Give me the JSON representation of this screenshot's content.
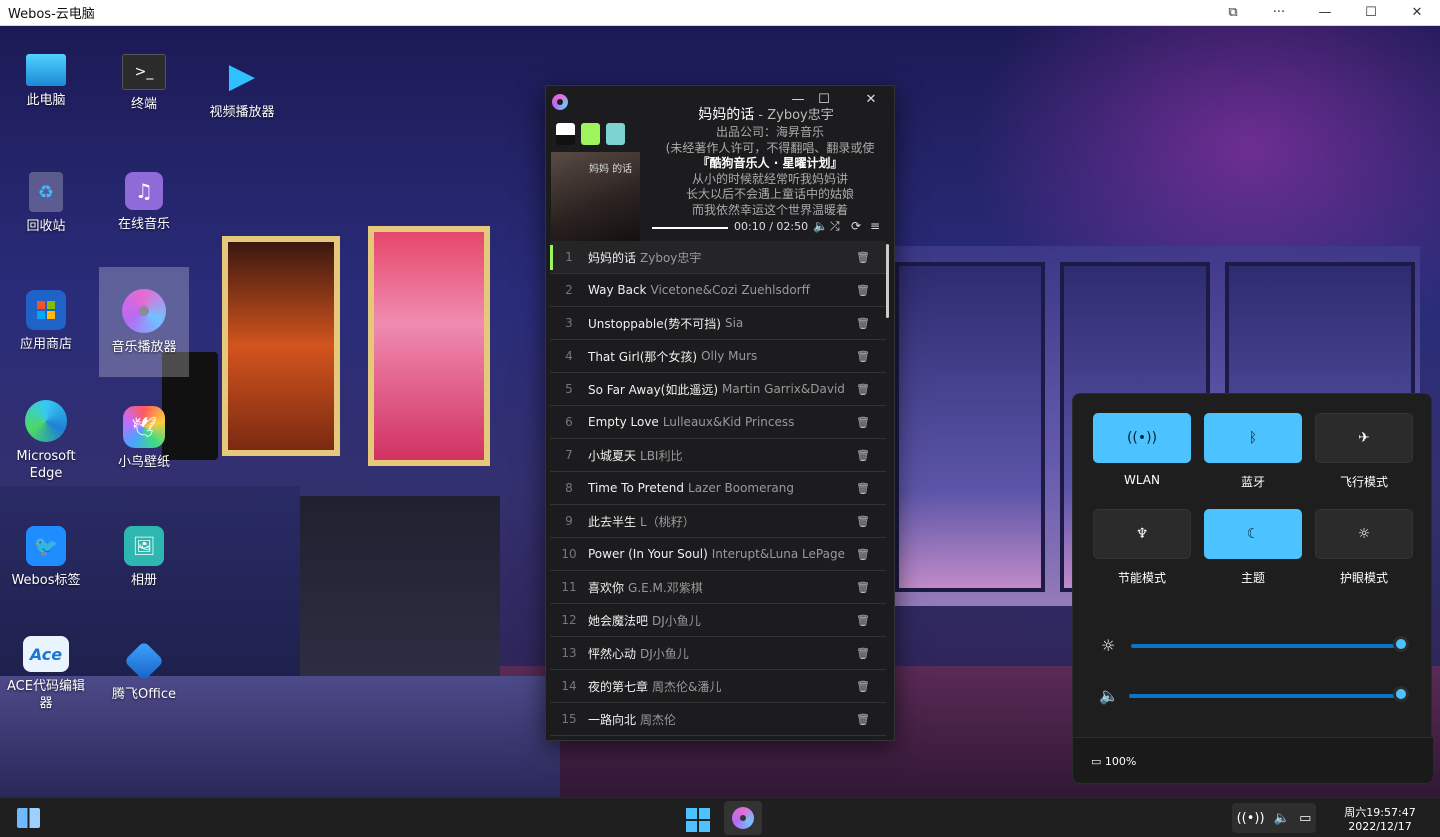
{
  "window": {
    "title": "Webos-云电脑"
  },
  "desktop_icons": [
    {
      "label": "此电脑",
      "icon": "monitor-icon"
    },
    {
      "label": "终端",
      "icon": "terminal-icon"
    },
    {
      "label": "视频播放器",
      "icon": "video-player-icon"
    },
    {
      "label": "回收站",
      "icon": "recycle-bin-icon"
    },
    {
      "label": "在线音乐",
      "icon": "music-note-icon"
    },
    {
      "label": "应用商店",
      "icon": "store-icon"
    },
    {
      "label": "音乐播放器",
      "icon": "music-disc-icon"
    },
    {
      "label": "Microsoft Edge",
      "icon": "edge-icon"
    },
    {
      "label": "小鸟壁纸",
      "icon": "bird-wallpaper-icon"
    },
    {
      "label": "Webos标签",
      "icon": "bird-tag-icon"
    },
    {
      "label": "相册",
      "icon": "photo-album-icon"
    },
    {
      "label": "ACE代码编辑器",
      "icon": "ace-editor-icon"
    },
    {
      "label": "腾飞Office",
      "icon": "office-icon"
    }
  ],
  "player": {
    "title": "妈妈的话",
    "artist": " - Zyboy忠宇",
    "swatches": [
      "#ffffff",
      "#9cf55d",
      "#7dd3d0"
    ],
    "cover_text": "妈妈 的话",
    "lyrics": [
      "出品公司：海昇音乐",
      "(未经著作人许可，不得翻唱、翻录或使",
      "『酷狗音乐人 · 星曜计划』",
      "从小的时候就经常听我妈妈讲",
      "长大以后不会遇上童话中的姑娘",
      "而我依然幸运这个世界温暖着"
    ],
    "time": "00:10 / 02:50",
    "progress": 0.06,
    "playlist": [
      {
        "num": "1",
        "name": "妈妈的话",
        "artist": "Zyboy忠宇"
      },
      {
        "num": "2",
        "name": "Way Back",
        "artist": "Vicetone&Cozi Zuehlsdorff"
      },
      {
        "num": "3",
        "name": "Unstoppable(势不可挡)",
        "artist": "Sia"
      },
      {
        "num": "4",
        "name": "That Girl(那个女孩)",
        "artist": "Olly Murs"
      },
      {
        "num": "5",
        "name": "So Far Away(如此遥远)",
        "artist": "Martin Garrix&David"
      },
      {
        "num": "6",
        "name": "Empty Love",
        "artist": "Lulleaux&Kid Princess"
      },
      {
        "num": "7",
        "name": "小城夏天",
        "artist": "LBI利比"
      },
      {
        "num": "8",
        "name": "Time To Pretend",
        "artist": "Lazer Boomerang"
      },
      {
        "num": "9",
        "name": "此去半生",
        "artist": "L（桃籽）"
      },
      {
        "num": "10",
        "name": "Power (In Your Soul)",
        "artist": "Interupt&Luna LePage"
      },
      {
        "num": "11",
        "name": "喜欢你",
        "artist": "G.E.M.邓紫棋"
      },
      {
        "num": "12",
        "name": "她会魔法吧",
        "artist": "DJ小鱼儿"
      },
      {
        "num": "13",
        "name": "怦然心动",
        "artist": "DJ小鱼儿"
      },
      {
        "num": "14",
        "name": "夜的第七章",
        "artist": "周杰伦&潘儿"
      },
      {
        "num": "15",
        "name": "一路向北",
        "artist": "周杰伦"
      }
    ]
  },
  "quick_settings": {
    "tiles": [
      {
        "label": "WLAN",
        "icon": "wifi-icon",
        "on": true
      },
      {
        "label": "蓝牙",
        "icon": "bluetooth-icon",
        "on": true
      },
      {
        "label": "飞行模式",
        "icon": "airplane-icon",
        "on": false
      },
      {
        "label": "节能模式",
        "icon": "leaf-icon",
        "on": false
      },
      {
        "label": "主题",
        "icon": "moon-icon",
        "on": true
      },
      {
        "label": "护眼模式",
        "icon": "sun-icon",
        "on": false
      }
    ],
    "brightness": 1.0,
    "volume": 1.0,
    "battery": "100%"
  },
  "taskbar": {
    "day_time": "周六19:57:47",
    "date": "2022/12/17"
  },
  "colors": {
    "accent": "#4cc2ff",
    "active_track": "#9cf55d"
  }
}
